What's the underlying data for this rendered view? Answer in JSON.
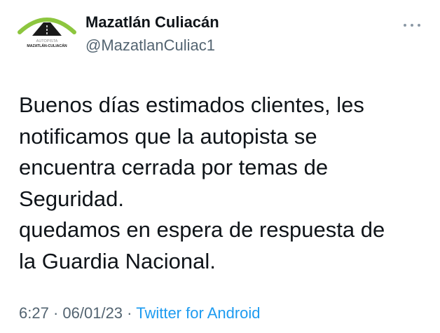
{
  "author": {
    "display_name": "Mazatlán Culiacán",
    "handle": "@MazatlanCuliac1",
    "avatar_caption_top": "AUTOPISTA",
    "avatar_caption_bottom": "MAZATLÁN-CULIACÁN"
  },
  "more_button": {
    "icon": "more-horizontal-icon"
  },
  "tweet": {
    "lines": [
      "Buenos días estimados clientes, les",
      "notificamos que la autopista se",
      "encuentra cerrada por temas de",
      "Seguridad.",
      "quedamos en espera de respuesta de",
      "la Guardia Nacional."
    ]
  },
  "meta": {
    "time": "6:27",
    "separator": "·",
    "date": "06/01/23",
    "source": "Twitter for Android"
  },
  "colors": {
    "text_primary": "#0f1419",
    "text_secondary": "#536471",
    "link": "#1d9bf0",
    "logo_green": "#8dc63f",
    "logo_dark": "#1a1a1a"
  }
}
